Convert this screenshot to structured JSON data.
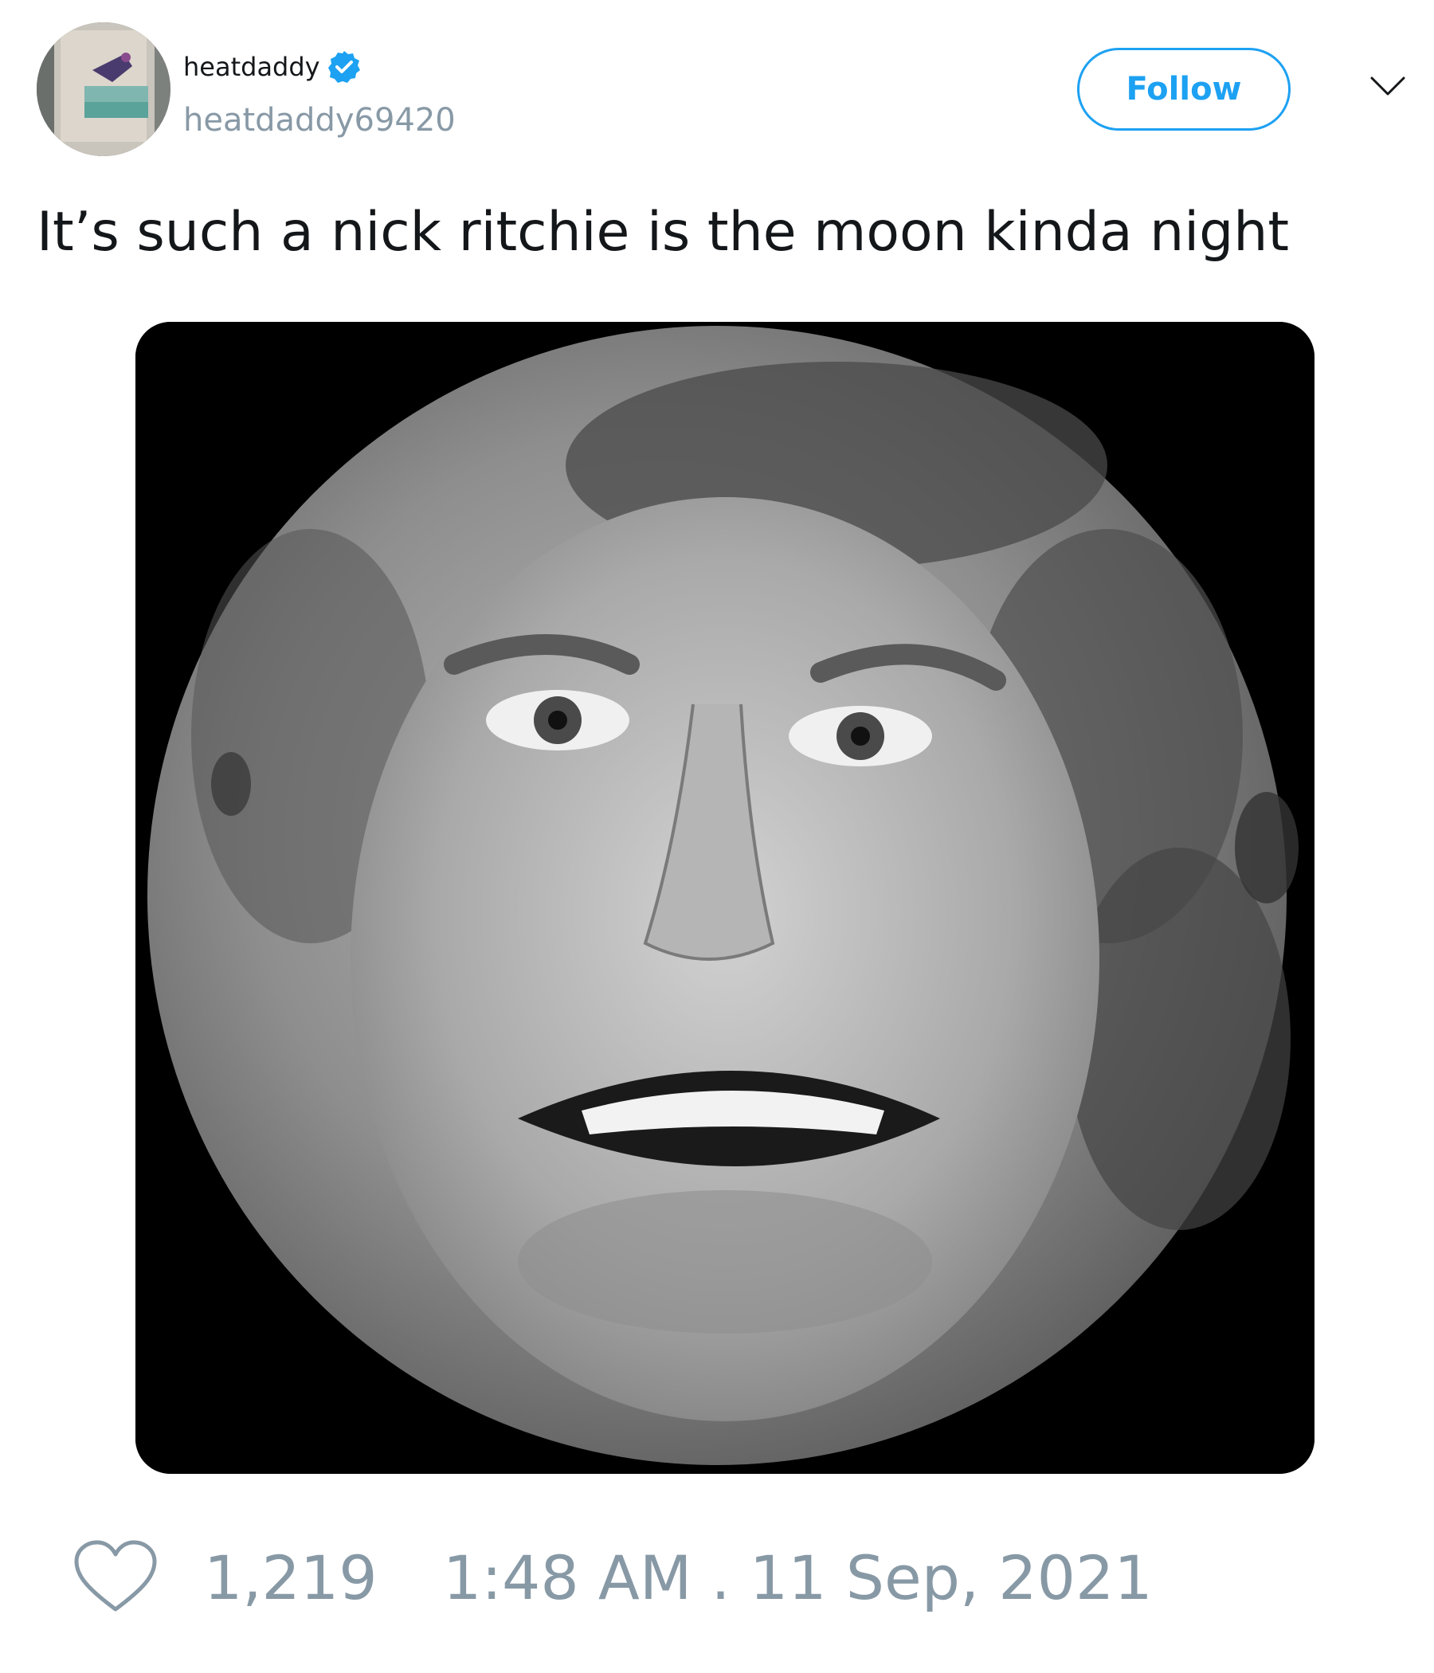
{
  "user": {
    "display_name": "heatdaddy",
    "handle": "heatdaddy69420",
    "verified": true
  },
  "header": {
    "follow_label": "Follow",
    "menu_icon": "chevron-down-icon"
  },
  "tweet": {
    "text": "It’s such a nick ritchie is the moon kinda night",
    "media_description_icon": "moon-face-image"
  },
  "footer": {
    "like_icon": "heart-icon",
    "like_count": "1,219",
    "timestamp": "1:48 AM . 11 Sep, 2021"
  },
  "colors": {
    "accent": "#1da1f2",
    "muted": "#8899a6",
    "text": "#14171a"
  }
}
